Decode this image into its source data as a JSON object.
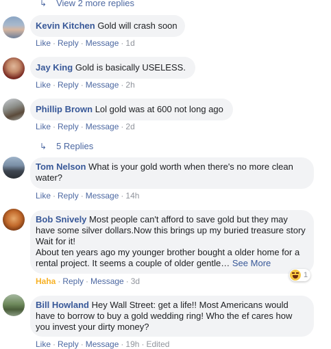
{
  "top_replies_link": {
    "label": "View 2 more replies"
  },
  "replies_link": {
    "label": "5 Replies"
  },
  "comments": [
    {
      "author": "Kevin Kitchen",
      "text": "Gold will crash soon",
      "actions": {
        "like": "Like",
        "reply": "Reply",
        "message": "Message",
        "time": "1d"
      }
    },
    {
      "author": "Jay King",
      "text": "Gold is basically USELESS.",
      "actions": {
        "like": "Like",
        "reply": "Reply",
        "message": "Message",
        "time": "2h"
      }
    },
    {
      "author": "Phillip Brown",
      "text": "Lol gold was at 600 not long ago",
      "actions": {
        "like": "Like",
        "reply": "Reply",
        "message": "Message",
        "time": "2d"
      }
    },
    {
      "author": "Tom Nelson",
      "text": "What is your gold worth when there's no more clean water?",
      "actions": {
        "like": "Like",
        "reply": "Reply",
        "message": "Message",
        "time": "14h"
      }
    },
    {
      "author": "Bob Snively",
      "text": "Most people can't afford to save gold but they may have some silver dollars.Now this brings up my buried treasure story Wait for it!",
      "text2": "About ten years ago my younger brother bought a older home for a rental project. It seems a couple of older gentle…",
      "see_more": "See More",
      "reaction_count": "1",
      "reaction_icon": "haha-emoji-icon",
      "actions": {
        "like": "Haha",
        "reply": "Reply",
        "message": "Message",
        "time": "3d"
      }
    },
    {
      "author": "Bill Howland",
      "text": "Hey Wall Street: get a life!! Most Americans would have to borrow to buy a gold wedding ring! Who the ef cares how you invest your dirty money?",
      "actions": {
        "like": "Like",
        "reply": "Reply",
        "message": "Message",
        "time": "19h",
        "edited": "Edited"
      }
    }
  ],
  "colors": {
    "link": "#385898",
    "bubble": "#f2f3f5",
    "meta": "#90949c",
    "haha": "#f7b125"
  }
}
